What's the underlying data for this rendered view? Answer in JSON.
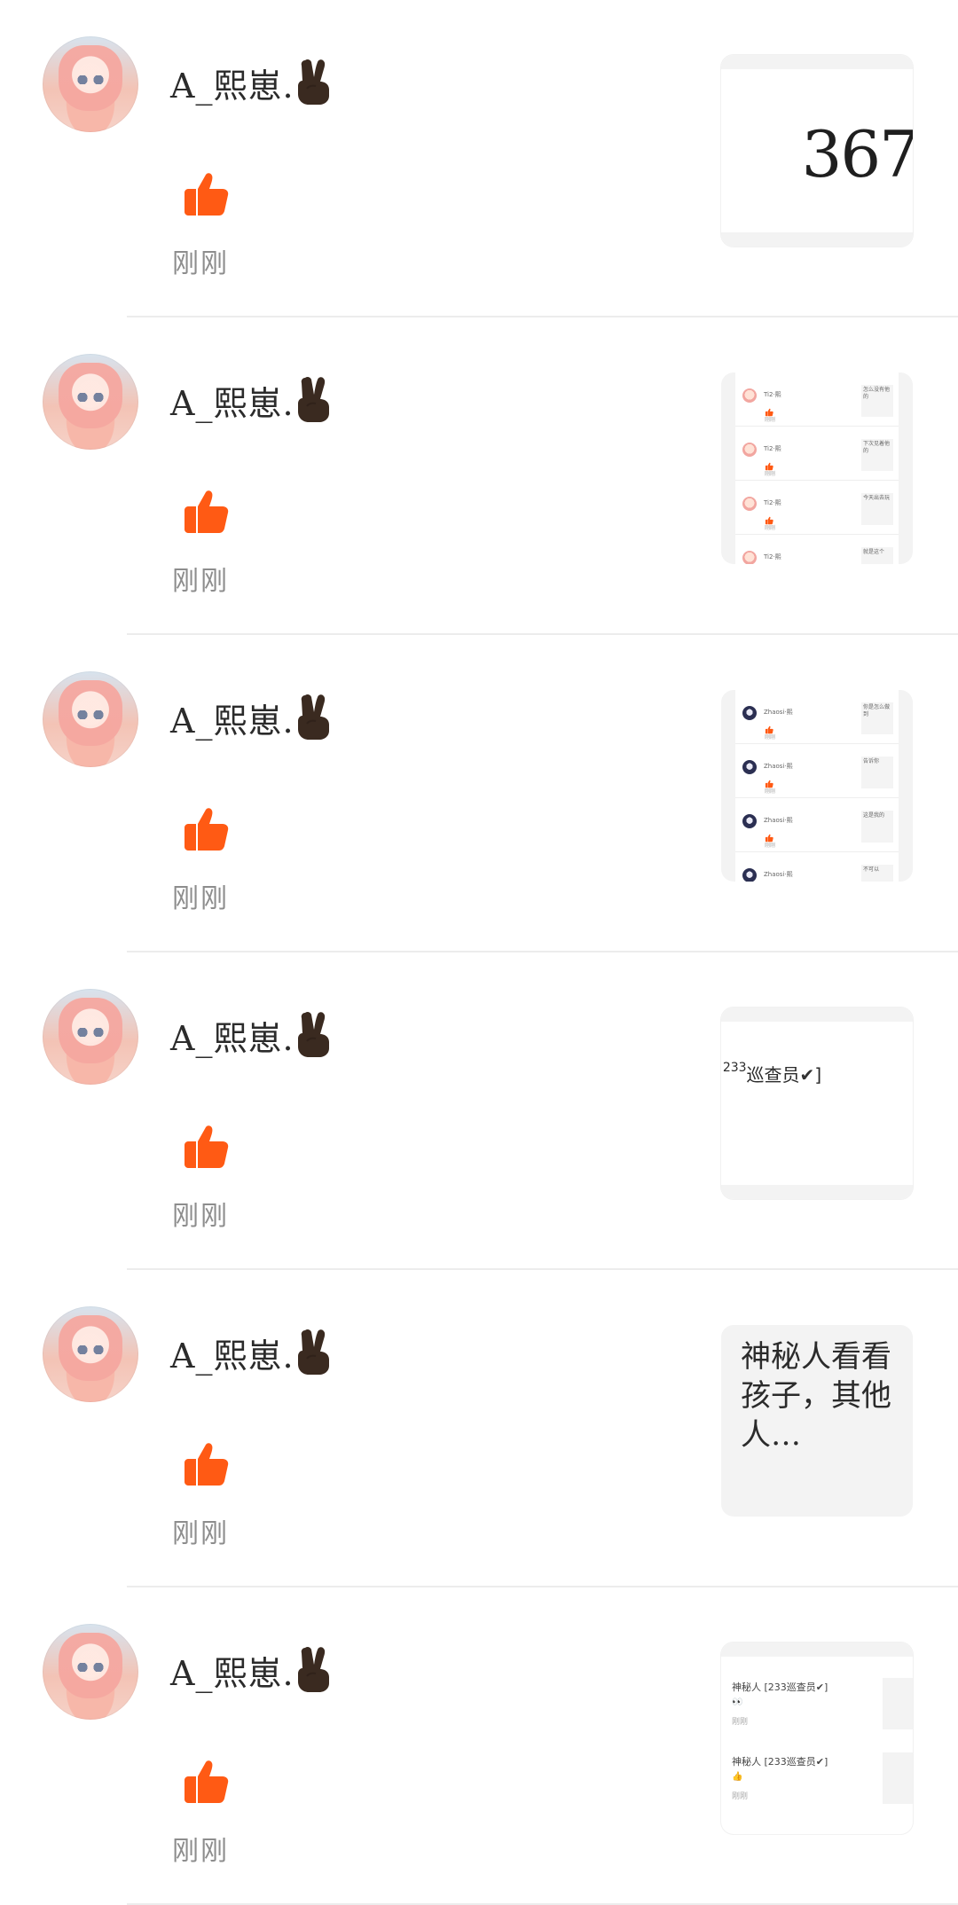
{
  "items": [
    {
      "username": "A_熙崽.",
      "time": "刚刚",
      "thumbnail": {
        "type": "number",
        "text": "367"
      }
    },
    {
      "username": "A_熙崽.",
      "time": "刚刚",
      "thumbnail": {
        "type": "screenshot-list",
        "rows": [
          {
            "name": "Ti2·熙",
            "time": "刚刚",
            "card": "怎么没有他的"
          },
          {
            "name": "Ti2·熙",
            "time": "刚刚",
            "card": "下次见着他的"
          },
          {
            "name": "Ti2·熙",
            "time": "刚刚",
            "card": "今天出去玩"
          },
          {
            "name": "Ti2·熙",
            "time": "刚刚",
            "card": "就是这个"
          }
        ]
      }
    },
    {
      "username": "A_熙崽.",
      "time": "刚刚",
      "thumbnail": {
        "type": "screenshot-list-dark",
        "rows": [
          {
            "name": "Zhaosi·熙",
            "time": "刚刚",
            "card": "你是怎么做到"
          },
          {
            "name": "Zhaosi·熙",
            "time": "刚刚",
            "card": "告诉你"
          },
          {
            "name": "Zhaosi·熙",
            "time": "刚刚",
            "card": "这是我的"
          },
          {
            "name": "Zhaosi·熙",
            "time": "刚刚",
            "card": "不可以"
          }
        ]
      }
    },
    {
      "username": "A_熙崽.",
      "time": "刚刚",
      "thumbnail": {
        "type": "tag",
        "text_left": "[",
        "sup": "233",
        "text": "巡查员",
        "check": "✔",
        "text_right": "]"
      }
    },
    {
      "username": "A_熙崽.",
      "time": "刚刚",
      "thumbnail": {
        "type": "text",
        "text": "神秘人看看孩子，其他人…"
      }
    },
    {
      "username": "A_熙崽.",
      "time": "刚刚",
      "thumbnail": {
        "type": "mini-tags",
        "rows": [
          {
            "line1": "神秘人 [233巡查员✔]",
            "line2": "👀",
            "line3": "刚刚"
          },
          {
            "line1": "神秘人 [233巡查员✔]",
            "line2": "👍",
            "line3": "刚刚"
          }
        ]
      }
    }
  ],
  "colors": {
    "accent": "#ff5a14",
    "separator": "#ececec",
    "muted": "#8d8d8d",
    "thumb_bg": "#f3f3f3"
  },
  "icons": {
    "like": "thumb-up-icon",
    "peace": "peace-hand-emoji-icon"
  }
}
